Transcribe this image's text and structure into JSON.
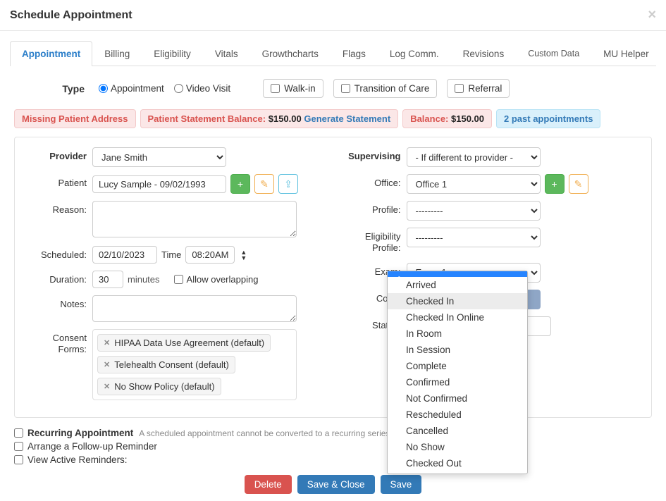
{
  "title": "Schedule Appointment",
  "tabs": [
    {
      "label": "Appointment",
      "active": true
    },
    {
      "label": "Billing"
    },
    {
      "label": "Eligibility"
    },
    {
      "label": "Vitals"
    },
    {
      "label": "Growthcharts"
    },
    {
      "label": "Flags"
    },
    {
      "label": "Log Comm."
    },
    {
      "label": "Revisions"
    },
    {
      "label": "Custom Data"
    },
    {
      "label": "MU Helper"
    }
  ],
  "type": {
    "label": "Type",
    "radios": [
      {
        "label": "Appointment",
        "checked": true
      },
      {
        "label": "Video Visit",
        "checked": false
      }
    ],
    "checks": [
      {
        "label": "Walk-in"
      },
      {
        "label": "Transition of Care"
      },
      {
        "label": "Referral"
      }
    ]
  },
  "alerts": {
    "missing_address": "Missing Patient Address",
    "statement_label": "Patient Statement Balance:",
    "statement_value": "$150.00",
    "generate": "Generate Statement",
    "balance_label": "Balance:",
    "balance_value": "$150.00",
    "past": "2 past appointments"
  },
  "left": {
    "provider_label": "Provider",
    "provider_value": "Jane Smith",
    "patient_label": "Patient",
    "patient_value": "Lucy Sample - 09/02/1993",
    "reason_label": "Reason:",
    "scheduled_label": "Scheduled:",
    "scheduled_date": "02/10/2023",
    "time_label": "Time",
    "time_value": "08:20AM",
    "duration_label": "Duration:",
    "duration_value": "30",
    "duration_unit": "minutes",
    "allow_overlap": "Allow overlapping",
    "notes_label": "Notes:",
    "consent_label": "Consent Forms:",
    "consents": [
      "HIPAA Data Use Agreement (default)",
      "Telehealth Consent (default)",
      "No Show Policy (default)"
    ]
  },
  "right": {
    "supervising_label": "Supervising",
    "supervising_value": "- If different to provider -",
    "office_label": "Office:",
    "office_value": "Office 1",
    "profile_label": "Profile:",
    "profile_value": "---------",
    "elig_label": "Eligibility Profile:",
    "elig_value": "---------",
    "exam_label": "Exam:",
    "exam_value": "Exam 1",
    "color_label": "Color:",
    "color_value": "#8fa6c6",
    "status_label": "Status:",
    "status_options": [
      "",
      "Arrived",
      "Checked In",
      "Checked In Online",
      "In Room",
      "In Session",
      "Complete",
      "Confirmed",
      "Not Confirmed",
      "Rescheduled",
      "Cancelled",
      "No Show",
      "Checked Out"
    ]
  },
  "bottom": {
    "recurring": "Recurring Appointment",
    "recurring_hint": "A scheduled appointment cannot be converted to a recurring series.",
    "followup": "Arrange a Follow-up Reminder",
    "active_rem": "View Active Reminders:"
  },
  "buttons": {
    "delete": "Delete",
    "save_close": "Save & Close",
    "save": "Save"
  }
}
